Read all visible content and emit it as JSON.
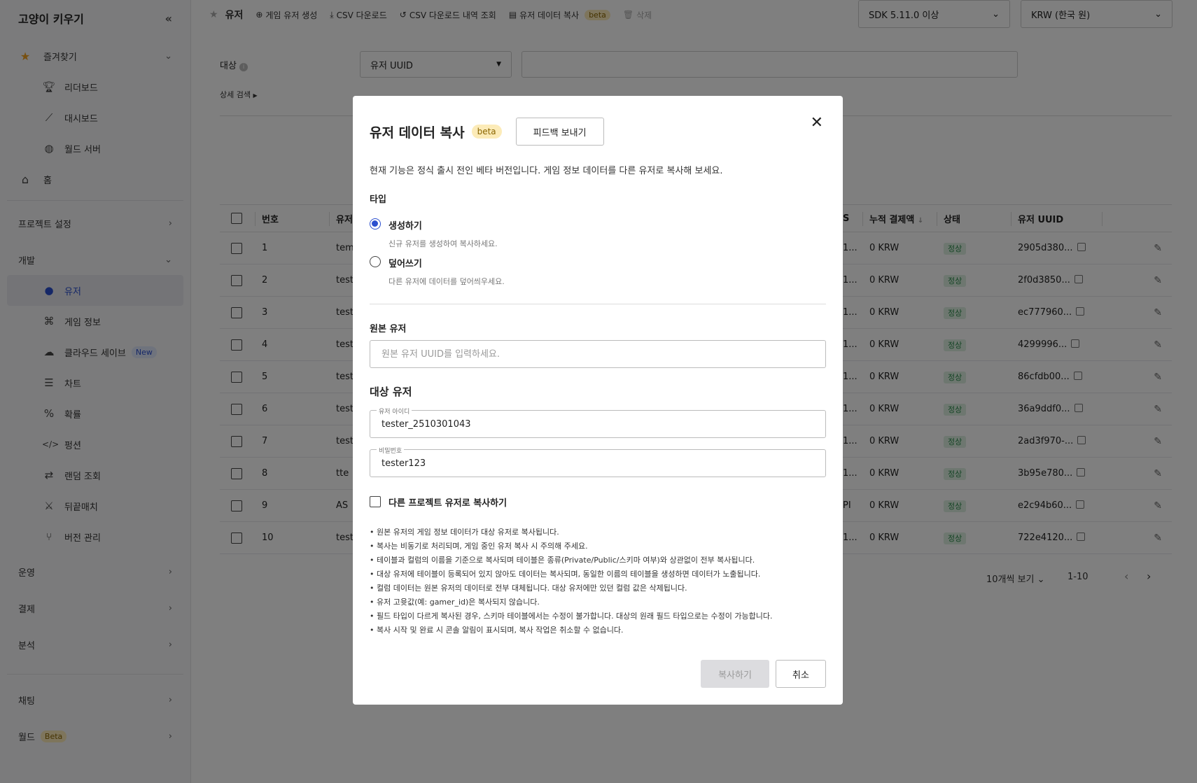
{
  "sidebar": {
    "project_name": "고양이 키우기",
    "collapse_icon": "double-chevron-left-icon",
    "favorites_label": "즐겨찾기",
    "favorites_items": [
      {
        "label": "리더보드",
        "icon": "trophy-icon"
      },
      {
        "label": "대시보드",
        "icon": "chart-line-icon"
      },
      {
        "label": "월드 서버",
        "icon": "globe-icon"
      }
    ],
    "home_label": "홈",
    "project_settings_label": "프로젝트 설정",
    "dev_label": "개발",
    "dev_items": [
      {
        "label": "유저",
        "icon": "user-icon",
        "active": true
      },
      {
        "label": "게임 정보",
        "icon": "gamepad-icon"
      },
      {
        "label": "클라우드 세이브",
        "icon": "cloud-save-icon",
        "badge": "New"
      },
      {
        "label": "차트",
        "icon": "table-icon"
      },
      {
        "label": "확률",
        "icon": "percent-icon"
      },
      {
        "label": "펑션",
        "icon": "code-icon"
      },
      {
        "label": "랜덤 조회",
        "icon": "shuffle-icon"
      },
      {
        "label": "뒤끝매치",
        "icon": "swords-icon"
      },
      {
        "label": "버전 관리",
        "icon": "branch-icon"
      }
    ],
    "ops_label": "운영",
    "payment_label": "결제",
    "analytics_label": "분석",
    "chat_label": "채팅",
    "world_label": "월드",
    "world_badge": "Beta"
  },
  "toolbar": {
    "title": "유저",
    "create_user": "게임 유저 생성",
    "csv_download": "CSV 다운로드",
    "csv_history": "CSV 다운로드 내역 조회",
    "copy_user_data": "유저 데이터 복사",
    "copy_beta": "beta",
    "delete": "삭제",
    "sdk_select": "SDK 5.11.0 이상",
    "currency_select": "KRW (한국 원)"
  },
  "search": {
    "label": "대상",
    "field_select": "유저 UUID",
    "advanced": "상세 검색"
  },
  "table": {
    "headers": {
      "no": "번호",
      "user": "유저",
      "s": "S",
      "total_paid": "누적 결제액",
      "status": "상태",
      "uuid": "유저 UUID"
    },
    "rows": [
      {
        "no": "1",
        "user": "tem",
        "s": "1...",
        "paid": "0 KRW",
        "status": "정상",
        "uuid": "2905d380..."
      },
      {
        "no": "2",
        "user": "test",
        "s": "1...",
        "paid": "0 KRW",
        "status": "정상",
        "uuid": "2f0d3850..."
      },
      {
        "no": "3",
        "user": "test",
        "s": "1...",
        "paid": "0 KRW",
        "status": "정상",
        "uuid": "ec777960..."
      },
      {
        "no": "4",
        "user": "test",
        "s": "1...",
        "paid": "0 KRW",
        "status": "정상",
        "uuid": "4299996..."
      },
      {
        "no": "5",
        "user": "test",
        "s": "1...",
        "paid": "0 KRW",
        "status": "정상",
        "uuid": "86cfdb00..."
      },
      {
        "no": "6",
        "user": "test",
        "s": "1...",
        "paid": "0 KRW",
        "status": "정상",
        "uuid": "36a9ddf0..."
      },
      {
        "no": "7",
        "user": "test",
        "s": "1...",
        "paid": "0 KRW",
        "status": "정상",
        "uuid": "2ad3f970-..."
      },
      {
        "no": "8",
        "user": "tte",
        "s": "1...",
        "paid": "0 KRW",
        "status": "정상",
        "uuid": "3b95e780..."
      },
      {
        "no": "9",
        "user": "AS",
        "s": "PI",
        "paid": "0 KRW",
        "status": "정상",
        "uuid": "e2c94b60..."
      },
      {
        "no": "10",
        "user": "test",
        "s": "1...",
        "paid": "0 KRW",
        "status": "정상",
        "uuid": "722e4120..."
      }
    ],
    "page_size": "10개씩 보기",
    "range": "1-10"
  },
  "modal": {
    "title": "유저 데이터 복사",
    "beta": "beta",
    "feedback_button": "피드백 보내기",
    "description": "현재 기능은 정식 출시 전인 베타 버전입니다. 게임 정보 데이터를 다른 유저로 복사해 보세요.",
    "type_label": "타입",
    "option_create": "생성하기",
    "option_create_hint": "신규 유저를 생성하여 복사하세요.",
    "option_overwrite": "덮어쓰기",
    "option_overwrite_hint": "다른 유저에 데이터를 덮어씌우세요.",
    "source_label": "원본 유저",
    "source_placeholder": "원본 유저 UUID를 입력하세요.",
    "target_label": "대상 유저",
    "user_id_label": "유저 아이디",
    "user_id_value": "tester_2510301043",
    "password_label": "비밀번호",
    "password_value": "tester123",
    "other_project_label": "다른 프로젝트 유저로 복사하기",
    "notes": [
      "원본 유저의 게임 정보 데이터가 대상 유저로 복사됩니다.",
      "복사는 비동기로 처리되며, 게임 중인 유저 복사 시 주의해 주세요.",
      "테이블과 컬럼의 이름을 기준으로 복사되며 테이블은 종류(Private/Public/스키마 여부)와 상관없이 전부 복사됩니다.",
      "대상 유저에 테이블이 등록되어 있지 않아도 데이터는 복사되며, 동일한 이름의 테이블을 생성하면 데이터가 노출됩니다.",
      "컬럼 데이터는 원본 유저의 데이터로 전부 대체됩니다. 대상 유저에만 있던 컬럼 값은 삭제됩니다.",
      "유저 고윳값(예: gamer_id)은 복사되지 않습니다.",
      "필드 타입이 다르게 복사된 경우, 스키마 테이블에서는 수정이 불가합니다. 대상의 원래 필드 타입으로는 수정이 가능합니다.",
      "복사 시작 및 완료 시 콘솔 알림이 표시되며, 복사 작업은 취소할 수 없습니다."
    ],
    "copy_button": "복사하기",
    "cancel_button": "취소"
  },
  "colors": {
    "accent": "#2b4fcf",
    "beta_bg": "#fcebb8",
    "status_green": "#2b8a4a"
  }
}
